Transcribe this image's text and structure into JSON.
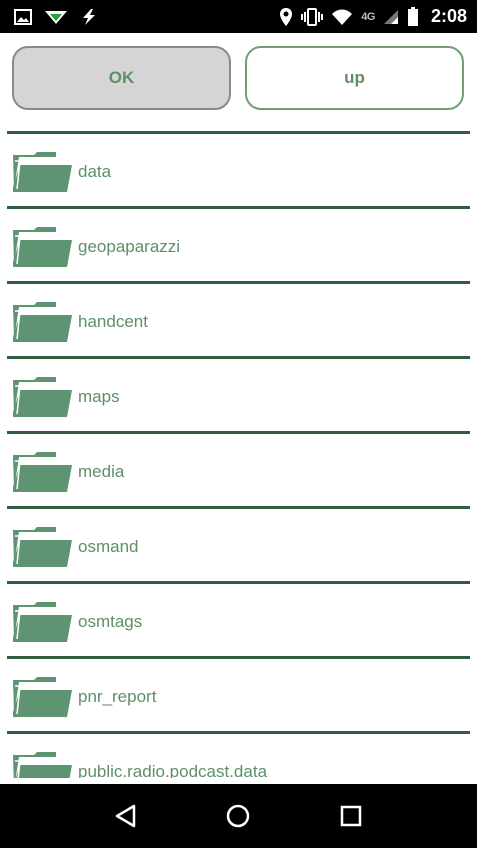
{
  "status_bar": {
    "time": "2:08",
    "network_label": "4G",
    "icons": [
      "image-icon",
      "signal-arrows-icon",
      "lightning-icon",
      "location-pin-icon",
      "vibrate-icon",
      "wifi-icon",
      "cell-signal-icon",
      "battery-icon"
    ]
  },
  "buttons": {
    "ok_label": "OK",
    "up_label": "up"
  },
  "folders": [
    {
      "label": "data"
    },
    {
      "label": "geopaparazzi"
    },
    {
      "label": "handcent"
    },
    {
      "label": "maps"
    },
    {
      "label": "media"
    },
    {
      "label": "osmand"
    },
    {
      "label": "osmtags"
    },
    {
      "label": "pnr_report"
    },
    {
      "label": "public.radio.podcast.data"
    }
  ],
  "colors": {
    "accent": "#5d8f69",
    "folder": "#5e9471",
    "divider": "#2f5e3f"
  },
  "nav_bar": {
    "icons": [
      "back-icon",
      "home-icon",
      "recents-icon"
    ]
  }
}
